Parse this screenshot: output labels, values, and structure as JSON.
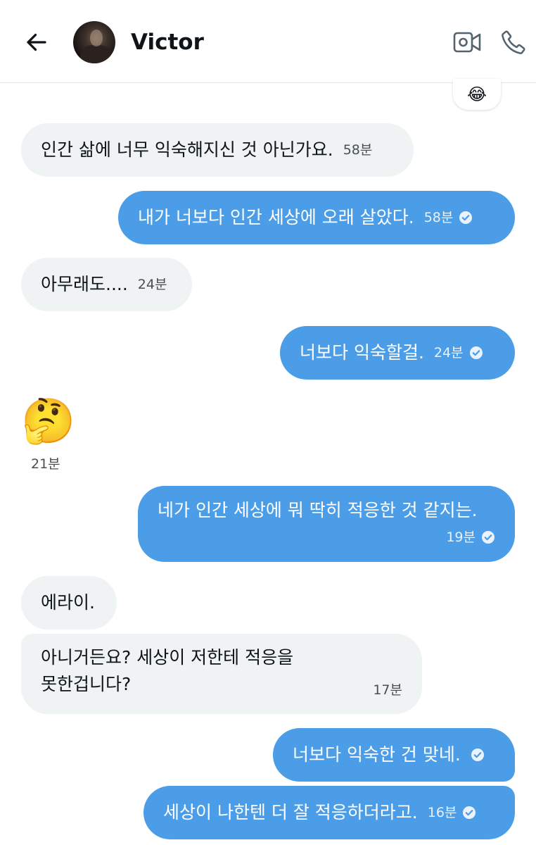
{
  "header": {
    "title": "Victor"
  },
  "reaction": {
    "emoji": "😂"
  },
  "messages": [
    {
      "text": "인간 삶에 너무 익숙해지신 것 아닌가요.",
      "time": "58분",
      "direction": "incoming"
    },
    {
      "text": "내가 너보다 인간 세상에 오래 살았다.",
      "time": "58분",
      "direction": "outgoing"
    },
    {
      "text": "아무래도....",
      "time": "24분",
      "direction": "incoming"
    },
    {
      "text": "너보다 익숙할걸.",
      "time": "24분",
      "direction": "outgoing"
    },
    {
      "emoji": "🤔",
      "time": "21분",
      "direction": "incoming"
    },
    {
      "text": "네가 인간 세상에 뭐 딱히 적응한 것 같지는.",
      "time": "19분",
      "direction": "outgoing"
    },
    {
      "text": "에라이.",
      "direction": "incoming"
    },
    {
      "text_line1": "아니거든요? 세상이 저한테 적응을",
      "text_line2": "못한겁니다?",
      "time": "17분",
      "direction": "incoming"
    },
    {
      "text": "너보다 익숙한 건 맞네.",
      "direction": "outgoing"
    },
    {
      "text": "세상이 나한텐 더 잘 적응하더라고.",
      "time": "16분",
      "direction": "outgoing"
    }
  ],
  "colors": {
    "outgoing_bubble": "#4a9de6",
    "incoming_bubble": "#eff3f4"
  },
  "icons": {
    "back": "arrow-left-icon",
    "video": "video-camera-icon",
    "phone": "phone-icon",
    "read": "check-circle-icon"
  }
}
